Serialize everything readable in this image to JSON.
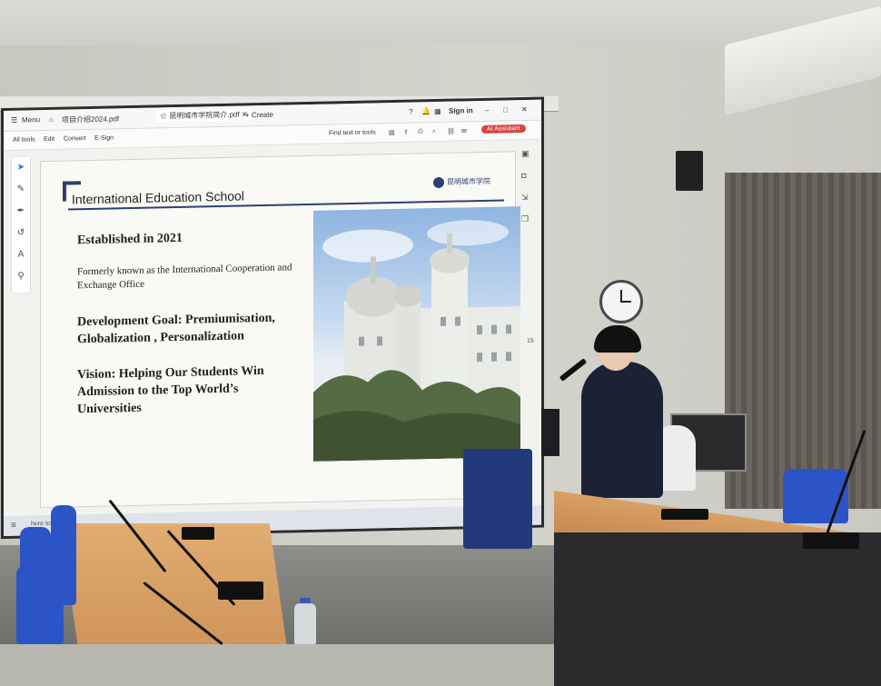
{
  "pdf_viewer": {
    "tabs": [
      {
        "label": "Menu"
      },
      {
        "label": "项目介绍2024.pdf"
      },
      {
        "label": "昆明城市学院简介.pdf"
      },
      {
        "label": "Create"
      }
    ],
    "sign_in": "Sign in",
    "toolbar": {
      "all_tools": "All tools",
      "edit": "Edit",
      "convert": "Convert",
      "esign": "E-Sign",
      "find": "Find text or tools",
      "ai_assistant": "AI Assistant"
    },
    "page_number": "15"
  },
  "slide": {
    "header": "International Education School",
    "logo_text": "昆明城市学院",
    "established": "Established in 2021",
    "formerly": "Formerly known as the International Cooperation and Exchange Office",
    "goal": "Development Goal: Premiumisation, Globalization , Personalization",
    "vision": "Vision:  Helping Our Students Win Admission to the Top World’s Universities"
  },
  "taskbar": {
    "search": "here to search"
  },
  "icons": [
    "menu-icon",
    "home-icon",
    "tab-close-icon",
    "help-icon",
    "bell-icon",
    "apps-icon",
    "minimize-icon",
    "maximize-icon",
    "close-icon",
    "cursor-icon",
    "comment-icon",
    "pen-icon",
    "loop-icon",
    "text-icon",
    "stamp-icon"
  ]
}
